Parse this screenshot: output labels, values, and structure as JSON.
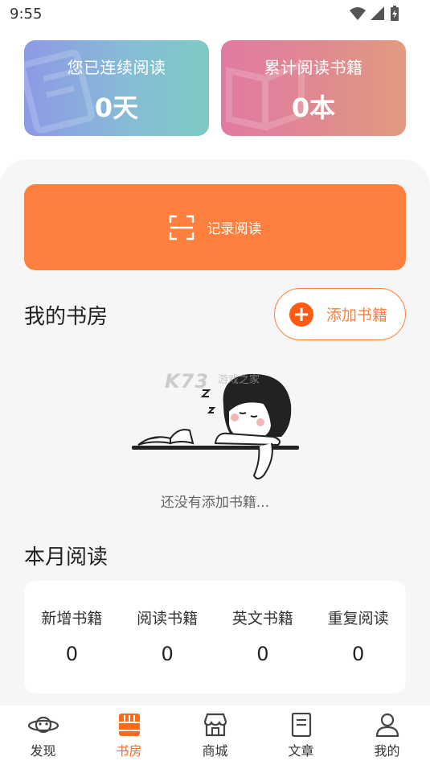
{
  "status_bar": {
    "time": "9:55"
  },
  "stats": {
    "continuous_label": "您已连续阅读",
    "continuous_value": "0天",
    "total_label": "累计阅读书籍",
    "total_value": "0本"
  },
  "record_button": {
    "label": "记录阅读",
    "icon": "scan-icon"
  },
  "bookroom": {
    "title": "我的书房",
    "add_button_label": "添加书籍",
    "empty_text": "还没有添加书籍...",
    "watermark": "K73",
    "watermark_sub": "游戏之家"
  },
  "monthly": {
    "title": "本月阅读",
    "items": [
      {
        "label": "新增书籍",
        "value": "0"
      },
      {
        "label": "阅读书籍",
        "value": "0"
      },
      {
        "label": "英文书籍",
        "value": "0"
      },
      {
        "label": "重复阅读",
        "value": "0"
      }
    ]
  },
  "nav": {
    "items": [
      {
        "label": "发现",
        "icon": "planet-icon"
      },
      {
        "label": "书房",
        "icon": "bookshelf-icon",
        "active": true
      },
      {
        "label": "商城",
        "icon": "store-icon"
      },
      {
        "label": "文章",
        "icon": "article-icon"
      },
      {
        "label": "我的",
        "icon": "profile-icon"
      }
    ]
  },
  "colors": {
    "accent": "#ff7f3e",
    "accent_dark": "#ff5a14",
    "nav_active": "#ff6a1a"
  }
}
